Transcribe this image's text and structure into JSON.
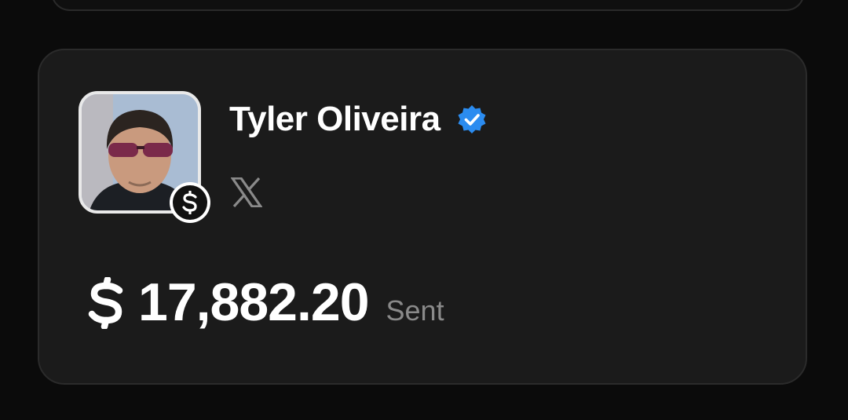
{
  "profile": {
    "name": "Tyler Oliveira",
    "verified": true,
    "verified_color": "#2b8cf0",
    "platform_icon": "x-logo-icon",
    "avatar_icon": "avatar",
    "badge_icon": "cash-dollar-icon"
  },
  "transaction": {
    "currency_icon": "dollar-sign-icon",
    "amount": "17,882.20",
    "status_label": "Sent"
  },
  "colors": {
    "background": "#0b0b0b",
    "card": "#1b1b1b",
    "text_primary": "#ffffff",
    "text_secondary": "#8a8a8a"
  }
}
